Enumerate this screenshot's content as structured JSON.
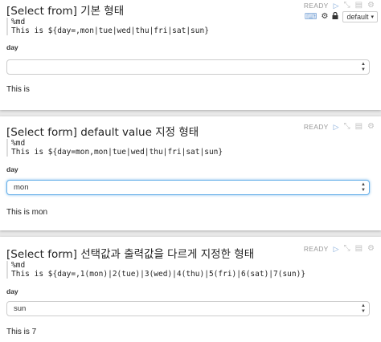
{
  "status": "READY",
  "interpreter_mode": "default",
  "paragraphs": [
    {
      "title": "[Select from] 기본 형태",
      "code": [
        "%md",
        "This is ${day=,mon|tue|wed|thu|fri|sat|sun}"
      ],
      "form_label": "day",
      "select_value": "",
      "result": "This is"
    },
    {
      "title": "[Select form] default value 지정 형태",
      "code": [
        "%md",
        "This is ${day=mon,mon|tue|wed|thu|fri|sat|sun}"
      ],
      "form_label": "day",
      "select_value": "mon",
      "result": "This is mon"
    },
    {
      "title": "[Select form] 선택값과 출력값을 다르게 지정한 형태",
      "code": [
        "%md",
        "This is ${day=,1(mon)|2(tue)|3(wed)|4(thu)|5(fri)|6(sat)|7(sun)}"
      ],
      "form_label": "day",
      "select_value": "sun",
      "result": "This is 7"
    }
  ]
}
